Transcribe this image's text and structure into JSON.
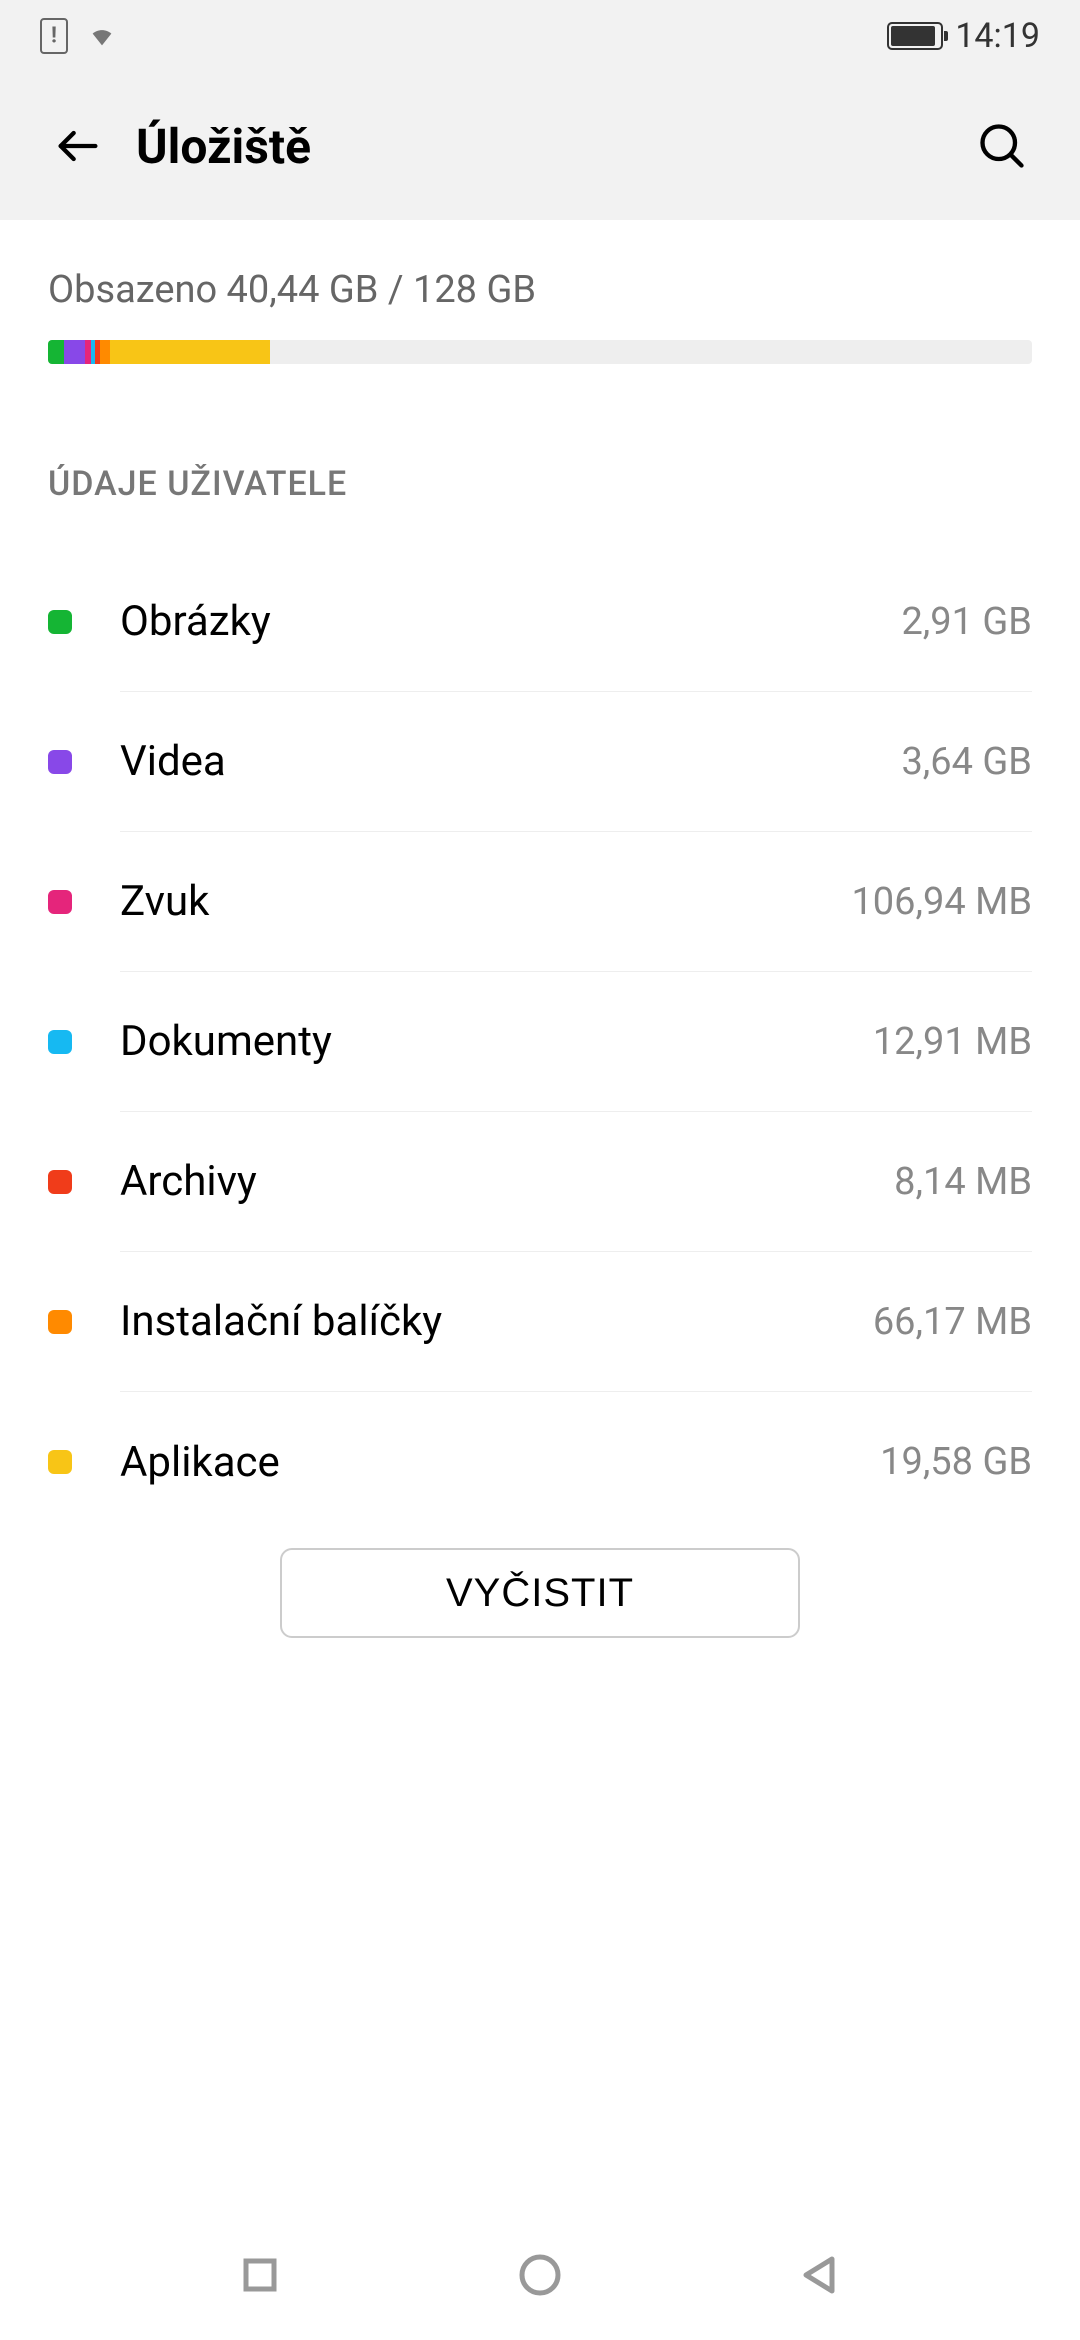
{
  "status": {
    "time": "14:19"
  },
  "header": {
    "title": "Úložiště"
  },
  "storage": {
    "usage_text": "Obsazeno 40,44 GB / 128 GB",
    "segments": [
      {
        "color": "#15b534",
        "width": 1.6
      },
      {
        "color": "#8848e8",
        "width": 2.2
      },
      {
        "color": "#e5257b",
        "width": 0.6
      },
      {
        "color": "#16b9f2",
        "width": 0.4
      },
      {
        "color": "#f03c1a",
        "width": 0.5
      },
      {
        "color": "#ff8a00",
        "width": 1.0
      },
      {
        "color": "#f8c516",
        "width": 16.3
      }
    ]
  },
  "section": {
    "header": "ÚDAJE UŽIVATELE"
  },
  "items": [
    {
      "label": "Obrázky",
      "value": "2,91 GB",
      "color": "#15b534"
    },
    {
      "label": "Videa",
      "value": "3,64 GB",
      "color": "#8848e8"
    },
    {
      "label": "Zvuk",
      "value": "106,94 MB",
      "color": "#e5257b"
    },
    {
      "label": "Dokumenty",
      "value": "12,91 MB",
      "color": "#16b9f2"
    },
    {
      "label": "Archivy",
      "value": "8,14 MB",
      "color": "#f03c1a"
    },
    {
      "label": "Instalační balíčky",
      "value": "66,17 MB",
      "color": "#ff8a00"
    },
    {
      "label": "Aplikace",
      "value": "19,58 GB",
      "color": "#f8c516"
    }
  ],
  "clean_button": "VYČISTIT"
}
